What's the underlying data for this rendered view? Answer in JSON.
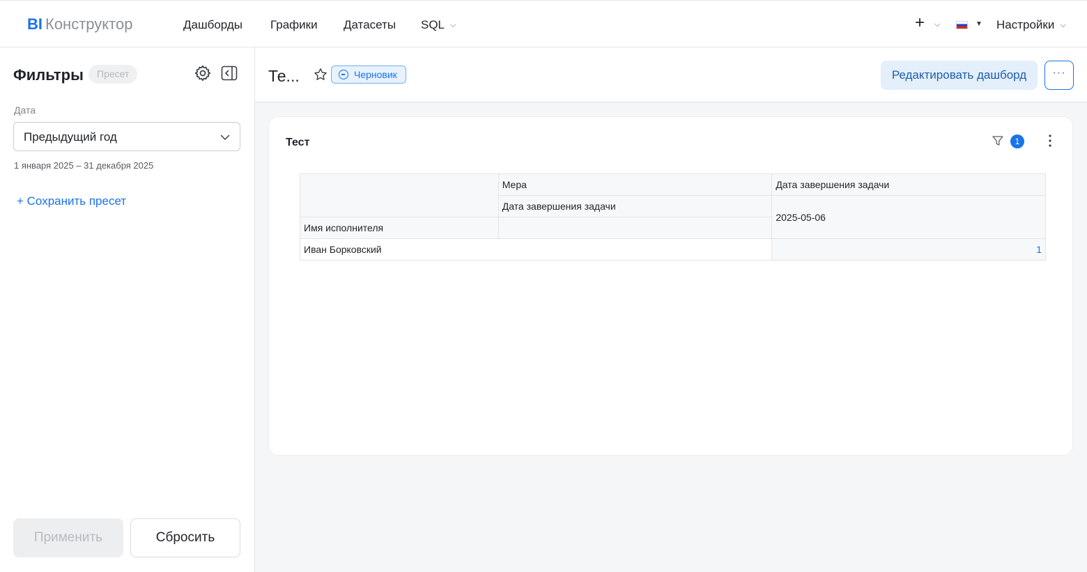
{
  "header": {
    "logo_bi": "BI",
    "logo_name": "Конструктор",
    "nav": {
      "dashboards": "Дашборды",
      "charts": "Графики",
      "datasets": "Датасеты",
      "sql": "SQL"
    },
    "plus": "+",
    "settings": "Настройки"
  },
  "sidebar": {
    "title": "Фильтры",
    "preset_chip": "Пресет",
    "date_label": "Дата",
    "date_value": "Предыдущий год",
    "date_range": "1 января 2025 – 31 декабря 2025",
    "save_preset": "+ Сохранить пресет",
    "apply_label": "Применить",
    "reset_label": "Сбросить"
  },
  "dashboard": {
    "title": "Те...",
    "draft_label": "Черновик",
    "edit_label": "Редактировать дашборд",
    "more_label": "···"
  },
  "widget": {
    "title": "Тест",
    "filter_count": "1",
    "table": {
      "measure_header": "Мера",
      "column_field": "Дата завершения задачи",
      "measure_name": "Дата завершения задачи",
      "column_value": "2025-05-06",
      "row_field": "Имя исполнителя",
      "rows": [
        {
          "name": "Иван Борковский",
          "value": "1"
        }
      ]
    }
  },
  "colors": {
    "accent": "#1a73e8",
    "draft_bg": "#e7f2fd",
    "edit_bg": "#e3effb"
  },
  "icons": [
    "gear-icon",
    "collapse-panel-icon",
    "chevron-down-icon",
    "star-icon",
    "minus-circle-icon",
    "filter-icon",
    "kebab-icon",
    "flag-ru-icon"
  ]
}
